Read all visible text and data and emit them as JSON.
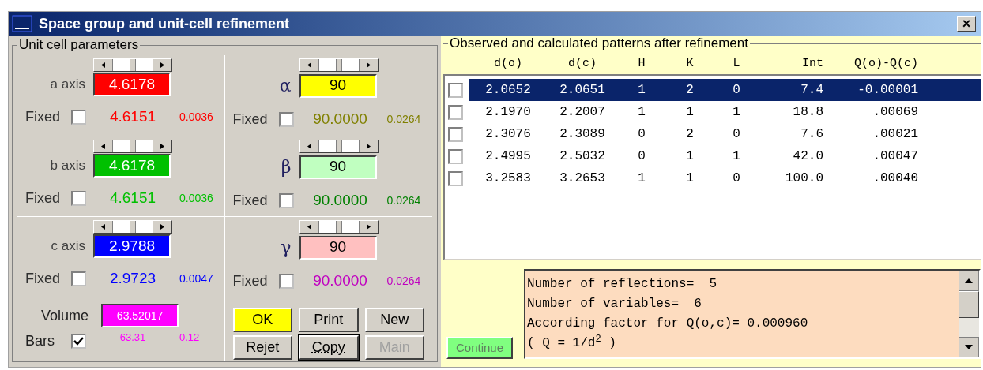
{
  "window": {
    "title": "Space group and unit-cell refinement",
    "close": "×"
  },
  "unit_cell": {
    "title": "Unit cell parameters",
    "params": [
      {
        "label": "a axis",
        "level": 0.5,
        "value": "4.6178",
        "color": "#ff0000",
        "fixed_label": "Fixed",
        "fixed": false,
        "result": {
          "refined": "4.6151",
          "error": "0.0036",
          "color": "#ff0000"
        }
      },
      {
        "label": "α",
        "level": 0.5,
        "value": "90",
        "color": "#ffff00",
        "fixed_label": "Fixed",
        "fixed": false,
        "result": {
          "refined": "90.0000",
          "error": "0.0264",
          "color": "#808000"
        }
      },
      {
        "label": "b axis",
        "level": 0.5,
        "value": "4.6178",
        "color": "#00c000",
        "fixed_label": "Fixed",
        "fixed": false,
        "result": {
          "refined": "4.6151",
          "error": "0.0036",
          "color": "#00c000"
        }
      },
      {
        "label": "β",
        "level": 0.5,
        "value": "90",
        "color": "#c0ffc0",
        "fixed_label": "Fixed",
        "fixed": false,
        "result": {
          "refined": "90.0000",
          "error": "0.0264",
          "color": "#008000"
        }
      },
      {
        "label": "c axis",
        "level": 0.5,
        "value": "2.9788",
        "color": "#0000ff",
        "fixed_label": "Fixed",
        "fixed": false,
        "result": {
          "refined": "2.9723",
          "error": "0.0047",
          "color": "#0000ff"
        }
      },
      {
        "label": "γ",
        "level": 0.5,
        "value": "90",
        "color": "#ffc0c0",
        "fixed_label": "Fixed",
        "fixed": false,
        "result": {
          "refined": "90.0000",
          "error": "0.0264",
          "color": "#c000c0"
        }
      }
    ],
    "volume": {
      "label": "Volume",
      "value": "63.52017"
    },
    "bars": {
      "label": "Bars",
      "checked": true,
      "value": "63.31",
      "error": "0.12"
    },
    "buttons": [
      {
        "label": "OK",
        "color": "#ffff00",
        "disabled": false,
        "focused": false
      },
      {
        "label": "Print",
        "color": "#d4d0c8",
        "disabled": false,
        "focused": false
      },
      {
        "label": "New",
        "color": "#d4d0c8",
        "disabled": false,
        "focused": false
      },
      {
        "label": "Rejet",
        "color": "#d4d0c8",
        "disabled": false,
        "focused": false
      },
      {
        "label": "Copy",
        "color": "#d4d0c8",
        "disabled": false,
        "focused": true
      },
      {
        "label": "Main",
        "color": "#d4d0c8",
        "disabled": true,
        "focused": false
      }
    ]
  },
  "patterns": {
    "title": "Observed and calculated patterns after refinement",
    "columns": [
      "d(o)",
      "d(c)",
      "H",
      "K",
      "L",
      "Int",
      "Q(o)-Q(c)"
    ],
    "rows": [
      {
        "cells": [
          "2.0652",
          "2.0651",
          "1",
          "2",
          "0",
          "7.4",
          "-0.00001"
        ],
        "selected": true,
        "checked": false
      },
      {
        "cells": [
          "2.1970",
          "2.2007",
          "1",
          "1",
          "1",
          "18.8",
          ".00069"
        ],
        "selected": false,
        "checked": false
      },
      {
        "cells": [
          "2.3076",
          "2.3089",
          "0",
          "2",
          "0",
          "7.6",
          ".00021"
        ],
        "selected": false,
        "checked": false
      },
      {
        "cells": [
          "2.4995",
          "2.5032",
          "0",
          "1",
          "1",
          "42.0",
          ".00047"
        ],
        "selected": false,
        "checked": false
      },
      {
        "cells": [
          "3.2583",
          "3.2653",
          "1",
          "1",
          "0",
          "100.0",
          ".00040"
        ],
        "selected": false,
        "checked": false
      }
    ],
    "continue_button": "Continue",
    "log": [
      "Number of reflections=  5",
      "Number of variables=  6",
      "According factor for Q(o,c)= 0.000960",
      "( Q = 1/d$^{2}$ )"
    ]
  }
}
